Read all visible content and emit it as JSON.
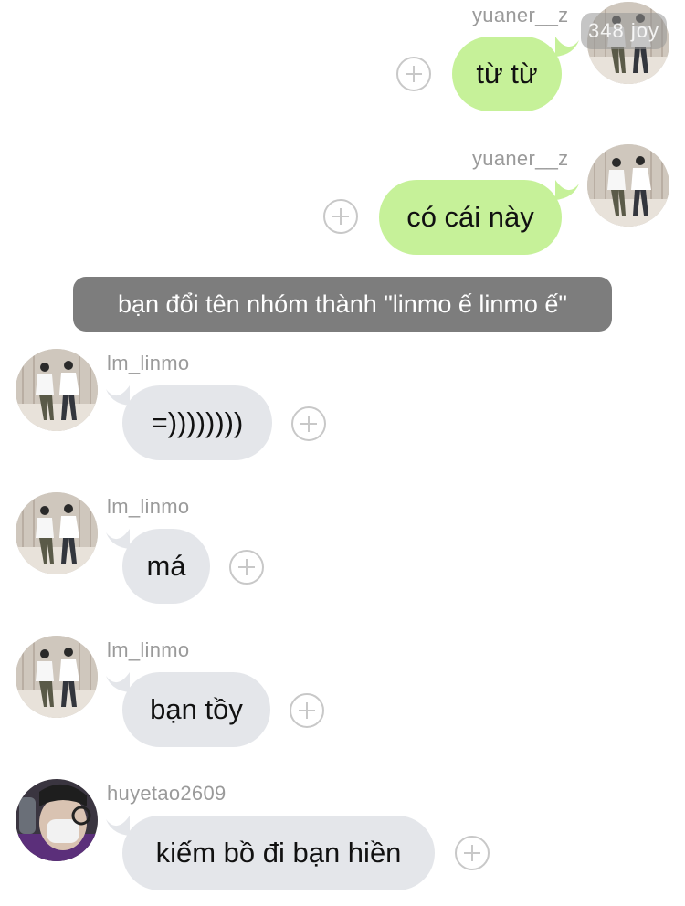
{
  "messages": [
    {
      "author": "yuaner__z",
      "text": "từ từ",
      "direction": "outgoing"
    },
    {
      "author": "yuaner__z",
      "text": "có cái này",
      "direction": "outgoing"
    },
    {
      "author": "lm_linmo",
      "text": "=))))))))",
      "direction": "incoming"
    },
    {
      "author": "lm_linmo",
      "text": "má",
      "direction": "incoming"
    },
    {
      "author": "lm_linmo",
      "text": "bạn tồy",
      "direction": "incoming"
    },
    {
      "author": "huyetao2609",
      "text": "kiếm bồ đi bạn hiền",
      "direction": "incoming"
    }
  ],
  "system_notice": "bạn đổi tên nhóm thành \"linmo ế linmo ế\"",
  "viewers_badge": "348 joy",
  "colors": {
    "outgoing_bubble": "#c6f199",
    "incoming_bubble": "#e4e6ea",
    "system_pill": "#7d7d7d",
    "name_text": "#9a9a9a"
  },
  "icons": {
    "reaction": "add-circle-icon",
    "avatar_pair": "avatar-two-people-icon",
    "avatar_selfie": "avatar-selfie-icon"
  }
}
